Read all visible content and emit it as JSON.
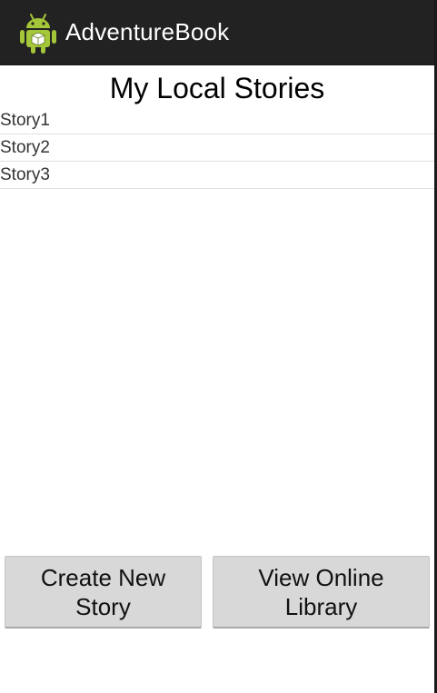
{
  "action_bar": {
    "title": "AdventureBook",
    "icon": "android-robot-icon",
    "background": "#222222",
    "icon_color": "#a4c639"
  },
  "main": {
    "title": "My Local Stories",
    "stories": [
      {
        "label": "Story1"
      },
      {
        "label": "Story2"
      },
      {
        "label": "Story3"
      }
    ]
  },
  "buttons": {
    "create_label": "Create New\nStory",
    "online_label": "View Online\nLibrary"
  }
}
